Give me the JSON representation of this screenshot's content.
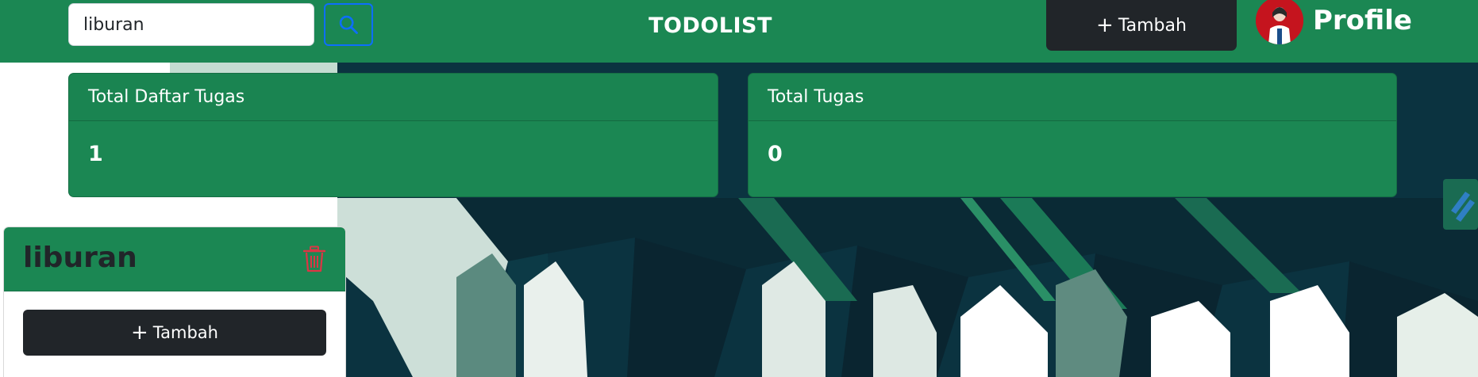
{
  "navbar": {
    "search": {
      "value": "liburan"
    },
    "brand": "TODOLIST",
    "add_button_label": "Tambah",
    "profile_label": "Profile"
  },
  "stats": [
    {
      "label": "Total Daftar Tugas",
      "value": "1"
    },
    {
      "label": "Total Tugas",
      "value": "0"
    }
  ],
  "lists": [
    {
      "title": "liburan",
      "add_task_label": "Tambah"
    }
  ],
  "colors": {
    "primary_green": "#1b8753",
    "dark_button": "#212529",
    "search_accent": "#0d6efd",
    "trash_red": "#dc3545",
    "background_teal": "#0b3340"
  },
  "icons": {
    "search_button": "search-icon",
    "add_buttons": "plus-icon",
    "list_delete": "trash-icon",
    "profile": "avatar"
  }
}
